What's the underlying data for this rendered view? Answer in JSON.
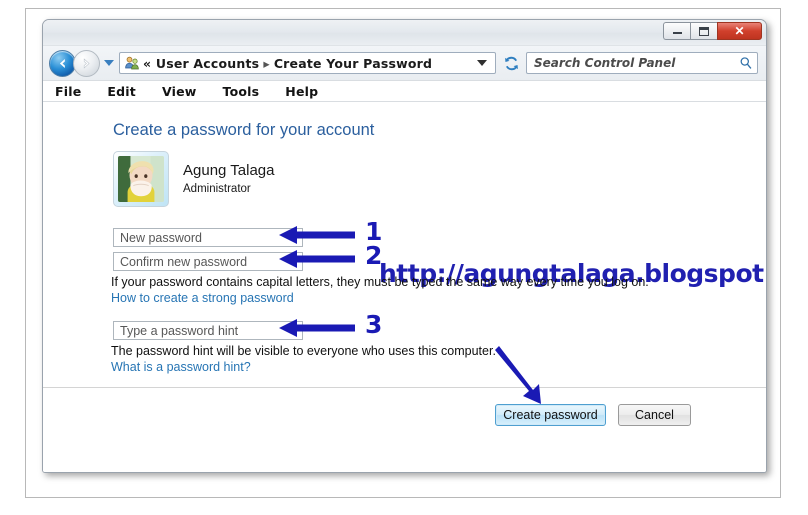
{
  "window": {
    "controls": {
      "minimize": "minimize-button",
      "maximize": "maximize-button",
      "close_label": "✕"
    }
  },
  "navigation": {
    "back_icon": "back-arrow-icon",
    "forward_icon": "forward-arrow-icon",
    "history_dropdown_icon": "chevron-down-icon",
    "refresh_icon": "refresh-icon"
  },
  "address_bar": {
    "icon": "user-accounts-icon",
    "prefix": "«",
    "crumbs": [
      "User Accounts",
      "Create Your Password"
    ],
    "separator": "▸",
    "dropdown_icon": "chevron-down-icon"
  },
  "search": {
    "placeholder": "Search Control Panel",
    "icon": "search-icon"
  },
  "menubar": {
    "items": [
      "File",
      "Edit",
      "View",
      "Tools",
      "Help"
    ]
  },
  "main": {
    "page_title": "Create a password for your account",
    "account": {
      "avatar": "user-avatar-photo",
      "name": "Agung Talaga",
      "role": "Administrator"
    },
    "watermark": "http://agungtalaga.blogspot.com/",
    "fields": {
      "new_password_placeholder": "New password",
      "new_password_value": "",
      "confirm_password_placeholder": "Confirm new password",
      "confirm_password_value": "",
      "hint_placeholder": "Type a password hint",
      "hint_value": ""
    },
    "help_caps": "If your password contains capital letters, they must be typed the same way every time you log on.",
    "link_strong_password": "How to create a strong password",
    "help_hint_visible": "The password hint will be visible to everyone who uses this computer.",
    "link_what_is_hint": "What is a password hint?",
    "buttons": {
      "create": "Create password",
      "cancel": "Cancel"
    }
  },
  "annotations": {
    "numbers": [
      "1",
      "2",
      "3"
    ],
    "arrow_color": "#1a1ab4"
  },
  "colors": {
    "accent_blue": "#2b5f9e",
    "link_blue": "#2775b4",
    "annotation_blue": "#1a1ab4",
    "close_red": "#bf3420"
  }
}
